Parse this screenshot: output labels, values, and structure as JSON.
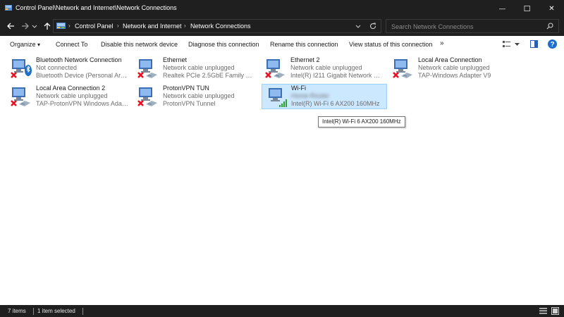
{
  "window": {
    "title": "Control Panel\\Network and Internet\\Network Connections",
    "minimize_glyph": "—",
    "maximize_glyph": "☐",
    "close_glyph": "✕"
  },
  "address": {
    "breadcrumbs": [
      "Control Panel",
      "Network and Internet",
      "Network Connections"
    ],
    "search_placeholder": "Search Network Connections"
  },
  "commands": {
    "organize": "Organize",
    "organize_arrow": "▾",
    "connect_to": "Connect To",
    "disable": "Disable this network device",
    "diagnose": "Diagnose this connection",
    "rename": "Rename this connection",
    "view_status": "View status of this connection",
    "more": "»"
  },
  "connections": [
    {
      "name": "Bluetooth Network Connection",
      "status": "Not connected",
      "device": "Bluetooth Device (Personal Area ...",
      "icon": "bluetooth-network-icon",
      "disconnected": true
    },
    {
      "name": "Ethernet",
      "status": "Network cable unplugged",
      "device": "Realtek PCIe 2.5GbE Family Contr...",
      "icon": "ethernet-icon",
      "disconnected": true
    },
    {
      "name": "Ethernet 2",
      "status": "Network cable unplugged",
      "device": "Intel(R) I211 Gigabit Network Con...",
      "icon": "ethernet-icon",
      "disconnected": true
    },
    {
      "name": "Local Area Connection",
      "status": "Network cable unplugged",
      "device": "TAP-Windows Adapter V9",
      "icon": "ethernet-icon",
      "disconnected": true
    },
    {
      "name": "Local Area Connection 2",
      "status": "Network cable unplugged",
      "device": "TAP-ProtonVPN Windows Adapte...",
      "icon": "ethernet-icon",
      "disconnected": true
    },
    {
      "name": "ProtonVPN TUN",
      "status": "Network cable unplugged",
      "device": "ProtonVPN Tunnel",
      "icon": "ethernet-icon",
      "disconnected": true
    },
    {
      "name": "Wi-Fi",
      "status": "Home-Router",
      "device": "Intel(R) Wi-Fi 6 AX200 160MHz",
      "icon": "wifi-icon",
      "disconnected": false,
      "selected": true
    }
  ],
  "tooltip": "Intel(R) Wi-Fi 6 AX200 160MHz",
  "status_bar": {
    "item_count": "7 items",
    "selected_count": "1 item selected"
  },
  "colors": {
    "chrome": "#1f1f1f",
    "selection": "#cce8ff",
    "selection_border": "#99d1ff",
    "error_red": "#e81123",
    "signal_green": "#2d9f2d",
    "help_blue": "#1e6fcc"
  }
}
